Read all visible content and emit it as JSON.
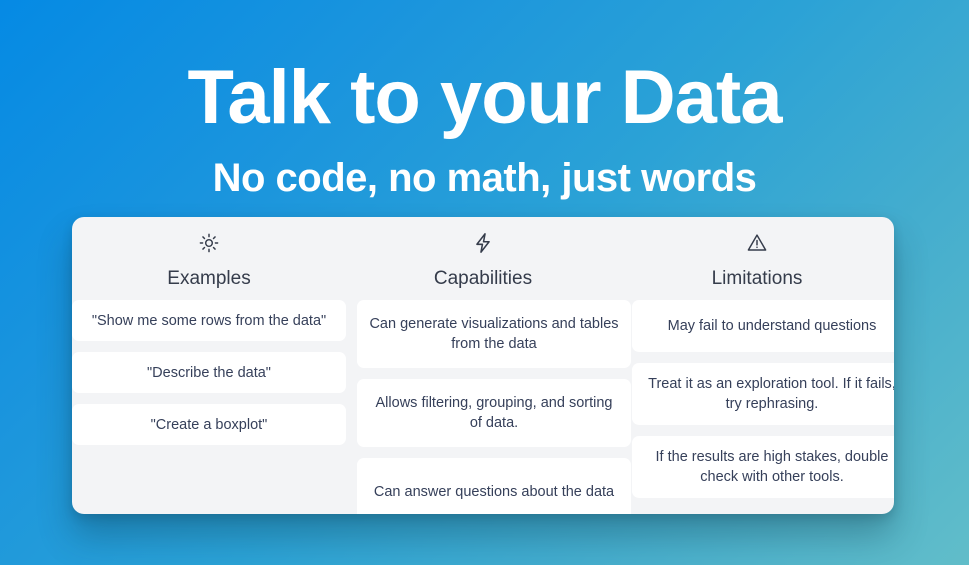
{
  "hero": {
    "title": "Talk to your Data",
    "subtitle": "No code, no math, just words"
  },
  "colors": {
    "background_top_left": "#058ae4",
    "background_bottom_right": "#61bdc9",
    "panel_background": "#f3f4f6",
    "card_background": "#ffffff",
    "text": "#36405a",
    "heading_text": "#353c4b",
    "hero_text": "#ffffff"
  },
  "panel": {
    "columns": [
      {
        "key": "examples",
        "icon": "sun-icon",
        "title": "Examples",
        "cards": [
          "\"Show me some rows from the data\"",
          "\"Describe the data\"",
          "\"Create a boxplot\""
        ]
      },
      {
        "key": "capabilities",
        "icon": "lightning-bolt-icon",
        "title": "Capabilities",
        "cards": [
          "Can generate visualizations and tables from the data",
          "Allows filtering, grouping, and sorting of data.",
          "Can answer questions about the data"
        ]
      },
      {
        "key": "limitations",
        "icon": "warning-triangle-icon",
        "title": "Limitations",
        "cards": [
          "May fail to understand questions",
          "Treat it as an exploration tool. If it fails, try rephrasing.",
          "If the results are high stakes, double check with other tools."
        ]
      }
    ]
  }
}
